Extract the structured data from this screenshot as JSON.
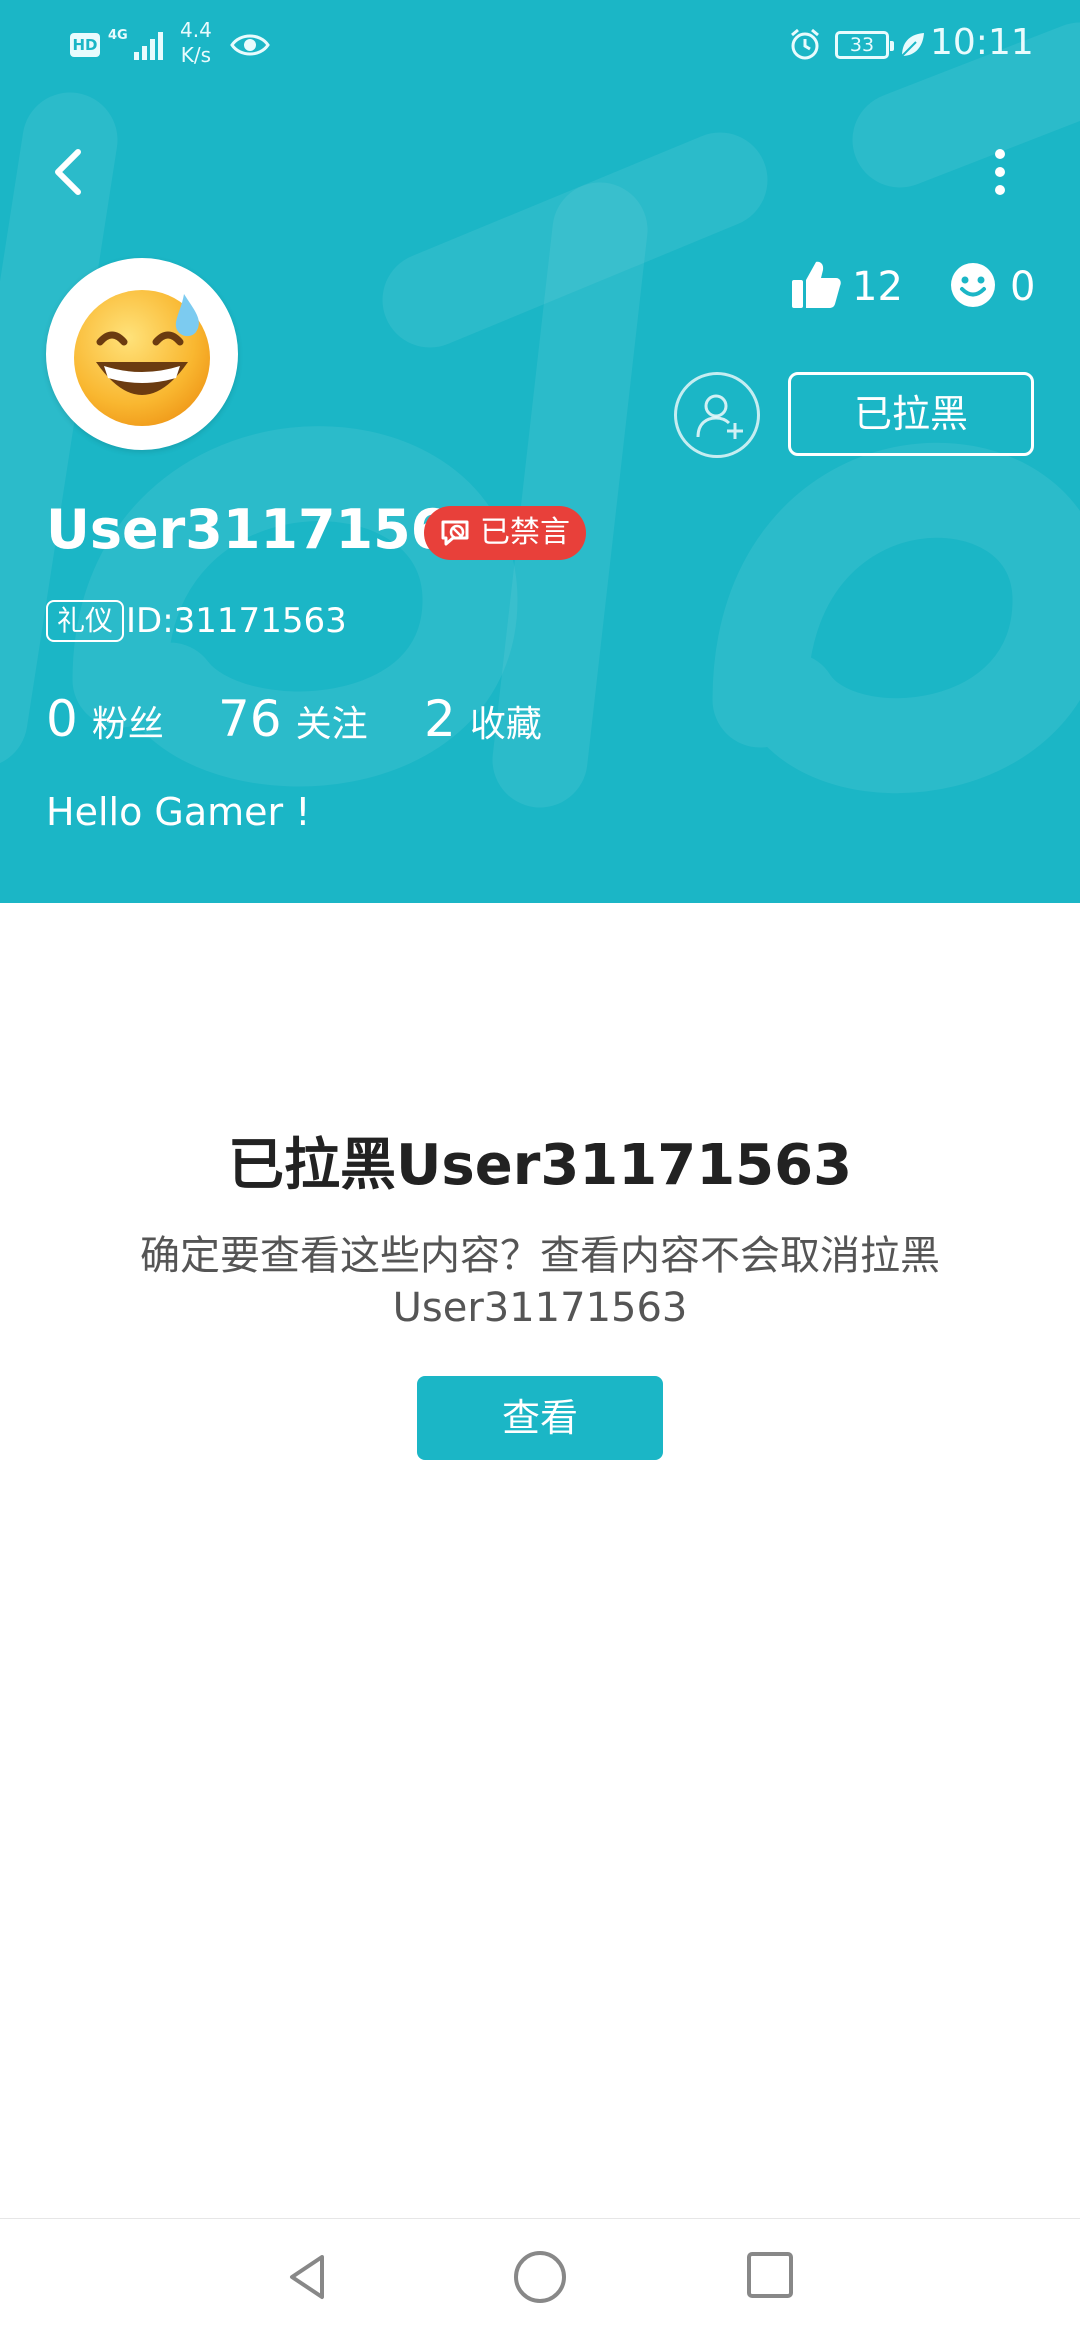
{
  "status_bar": {
    "network_hd": "HD",
    "network_type": "4G",
    "speed_value": "4.4",
    "speed_unit": "K/s",
    "battery": "33",
    "time": "10:11",
    "icons": [
      "signal-icon",
      "eye-icon",
      "alarm-icon",
      "battery-icon",
      "leaf-icon"
    ]
  },
  "header": {
    "accent_color": "#1bb6c6",
    "back_icon": "back-arrow-icon",
    "more_icon": "more-vertical-icon",
    "avatar_icon": "sweat-smile-emoji",
    "likes_count": "12",
    "smiles_count": "0",
    "follow_icon": "add-friend-icon",
    "blocked_label": "已拉黑",
    "username": "User31171563",
    "muted_badge": "已禁言",
    "muted_badge_color": "#e8403a",
    "etiquette_tag": "礼仪",
    "id_text": "ID:31171563",
    "stats": [
      {
        "value": "0",
        "label": "粉丝"
      },
      {
        "value": "76",
        "label": "关注"
      },
      {
        "value": "2",
        "label": "收藏"
      }
    ],
    "bio": "Hello Gamer !"
  },
  "content": {
    "title": "已拉黑User31171563",
    "description": "确定要查看这些内容？查看内容不会取消拉黑User31171563",
    "view_button": "查看"
  },
  "nav_bar": {
    "icons": [
      "nav-back-icon",
      "nav-home-icon",
      "nav-recents-icon"
    ]
  }
}
